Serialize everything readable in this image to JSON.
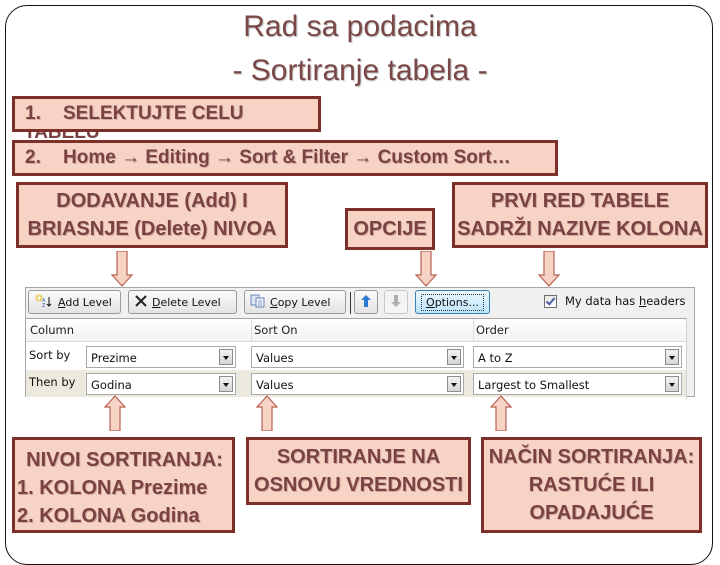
{
  "slide": {
    "title_line1": "Rad sa podacima",
    "title_line2": "- Sortiranje tabela -"
  },
  "steps": [
    {
      "num": "1.",
      "text": "SELEKTUJTE CELU",
      "overflow_text": "TABELU"
    },
    {
      "num": "2.",
      "text": "Home → Editing → Sort & Filter  → Custom Sort…"
    }
  ],
  "callouts": {
    "add_delete": {
      "line1": "DODAVANJE (Add) I",
      "line2": "BRIASNJE (Delete) NIVOA"
    },
    "options": {
      "line1": "OPCIJE"
    },
    "headers": {
      "line1": "PRVI RED TABELE",
      "line2": "SADRŽI NAZIVE KOLONA"
    },
    "levels": {
      "line1": "NIVOI SORTIRANJA:",
      "line2": "1.  KOLONA Prezime",
      "line3": "2.  KOLONA Godina"
    },
    "sort_on": {
      "line1": "SORTIRANJE NA",
      "line2": "OSNOVU VREDNOSTI"
    },
    "order": {
      "line1": "NAČIN SORTIRANJA:",
      "line2": "RASTUĆE ILI",
      "line3": "OPADAJUĆE"
    }
  },
  "colors": {
    "callout_fill": "#f7d3c6",
    "callout_border": "#7d2f2a",
    "callout_text": "#7a4242",
    "title_text": "#7a4747"
  },
  "dialog": {
    "toolbar": {
      "add_level": {
        "accel": "A",
        "rest": "dd Level",
        "icon": "add-level-icon"
      },
      "delete_level": {
        "accel": "D",
        "rest": "elete Level",
        "icon": "delete-x-icon"
      },
      "copy_level": {
        "accel": "C",
        "rest": "opy Level",
        "icon": "copy-icon"
      },
      "move_up": {
        "icon": "arrow-up-icon"
      },
      "move_down": {
        "icon": "arrow-down-icon"
      },
      "options": {
        "accel": "O",
        "rest": "ptions..."
      },
      "headers_checkbox": {
        "label_pre": "My data has ",
        "accel": "h",
        "label_post": "eaders",
        "checked": true
      }
    },
    "columns": [
      "Column",
      "Sort On",
      "Order"
    ],
    "rows": [
      {
        "label": "Sort by",
        "column": "Prezime",
        "sort_on": "Values",
        "order": "A to Z"
      },
      {
        "label": "Then by",
        "column": "Godina",
        "sort_on": "Values",
        "order": "Largest to Smallest"
      }
    ]
  }
}
